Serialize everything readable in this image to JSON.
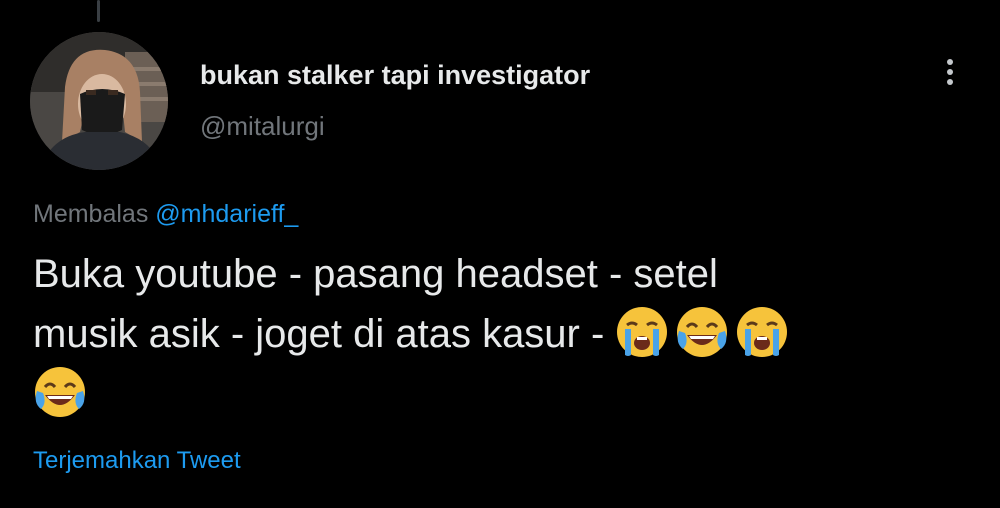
{
  "tweet": {
    "display_name": "bukan stalker tapi investigator",
    "handle": "@mitalurgi",
    "reply_prefix": "Membalas",
    "reply_mention": "@mhdarieff_",
    "text_line1": "Buka youtube - pasang headset - setel",
    "text_line2": "musik asik - joget di atas kasur -",
    "emojis": [
      "loudly-crying-face",
      "face-with-tears-of-joy",
      "loudly-crying-face",
      "face-with-tears-of-joy"
    ],
    "translate_label": "Terjemahkan Tweet"
  },
  "colors": {
    "background": "#000000",
    "text_primary": "#e7e9ea",
    "text_secondary": "#71767b",
    "accent": "#1d9bf0"
  },
  "icons": {
    "more": "more-vertical-icon"
  }
}
